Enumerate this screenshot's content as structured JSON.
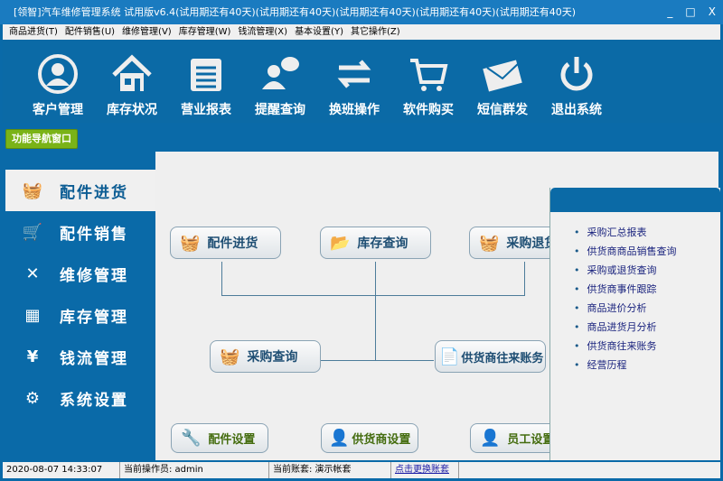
{
  "window": {
    "title": "[领智]汽车维修管理系统 试用版v6.4(试用期还有40天)(试用期还有40天)(试用期还有40天)(试用期还有40天)(试用期还有40天)",
    "minimize": "_",
    "maximize": "□",
    "close": "X"
  },
  "menu": [
    "商品进货(T)",
    "配件销售(U)",
    "维修管理(V)",
    "库存管理(W)",
    "钱流管理(X)",
    "基本设置(Y)",
    "其它操作(Z)"
  ],
  "toolbar": [
    "客户管理",
    "库存状况",
    "营业报表",
    "提醒查询",
    "换班操作",
    "软件购买",
    "短信群发",
    "退出系统"
  ],
  "nav_window_button": "功能导航窗口",
  "sidebar": [
    "配件进货",
    "配件销售",
    "维修管理",
    "库存管理",
    "钱流管理",
    "系统设置"
  ],
  "flow": {
    "parts_in": "配件进货",
    "stock_query": "库存查询",
    "purchase_return": "采购退货",
    "purchase_query": "采购查询",
    "supplier_accounts": "供货商往来账务",
    "parts_setup": "配件设置",
    "supplier_setup": "供货商设置",
    "staff_setup": "员工设置"
  },
  "panel_links": [
    "采购汇总报表",
    "供货商商品销售查询",
    "采购或退货查询",
    "供货商事件跟踪",
    "商品进价分析",
    "商品进货月分析",
    "供货商往来账务",
    "经营历程"
  ],
  "status": {
    "datetime": "2020-08-07 14:33:07",
    "operator": "当前操作员: admin",
    "account": "当前账套: 演示帐套",
    "switch": "点击更换账套"
  }
}
